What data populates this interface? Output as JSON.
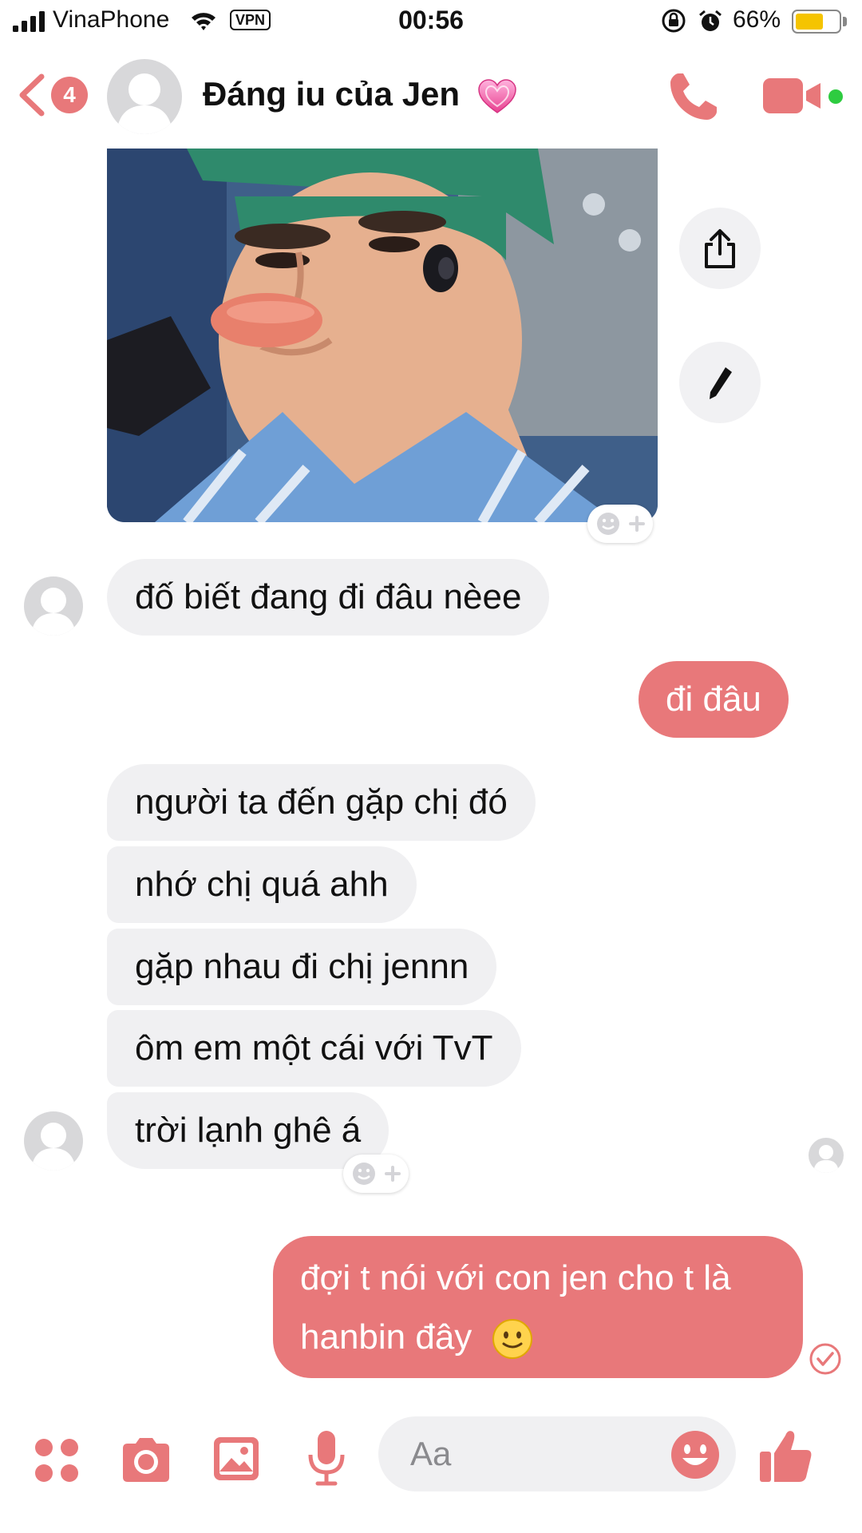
{
  "status_bar": {
    "carrier": "VinaPhone",
    "vpn": "VPN",
    "time": "00:56",
    "battery": "66%",
    "battery_level": 0.66
  },
  "header": {
    "unread_count": "4",
    "contact_name": "Đáng iu của Jen",
    "name_emoji_icon": "pink-heart-icon"
  },
  "colors": {
    "accent": "#e8787a",
    "incoming_bubble": "#f0f0f2",
    "online": "#2ecc40",
    "battery": "#f5c400"
  },
  "messages": [
    {
      "side": "incoming",
      "text": "đố biết đang đi đâu nèee"
    },
    {
      "side": "outgoing",
      "text": "đi đâu"
    },
    {
      "side": "incoming",
      "text": "người ta đến gặp chị đó"
    },
    {
      "side": "incoming",
      "text": "nhớ chị quá ahh"
    },
    {
      "side": "incoming",
      "text": "gặp nhau đi chị jennn"
    },
    {
      "side": "incoming",
      "text": "ôm em một cái với TvT"
    },
    {
      "side": "incoming",
      "text": "trời lạnh ghê á"
    },
    {
      "side": "outgoing",
      "line1": "đợi t nói với con jen cho t là",
      "line2": "hanbin đây"
    }
  ],
  "composer": {
    "placeholder": "Aa"
  }
}
